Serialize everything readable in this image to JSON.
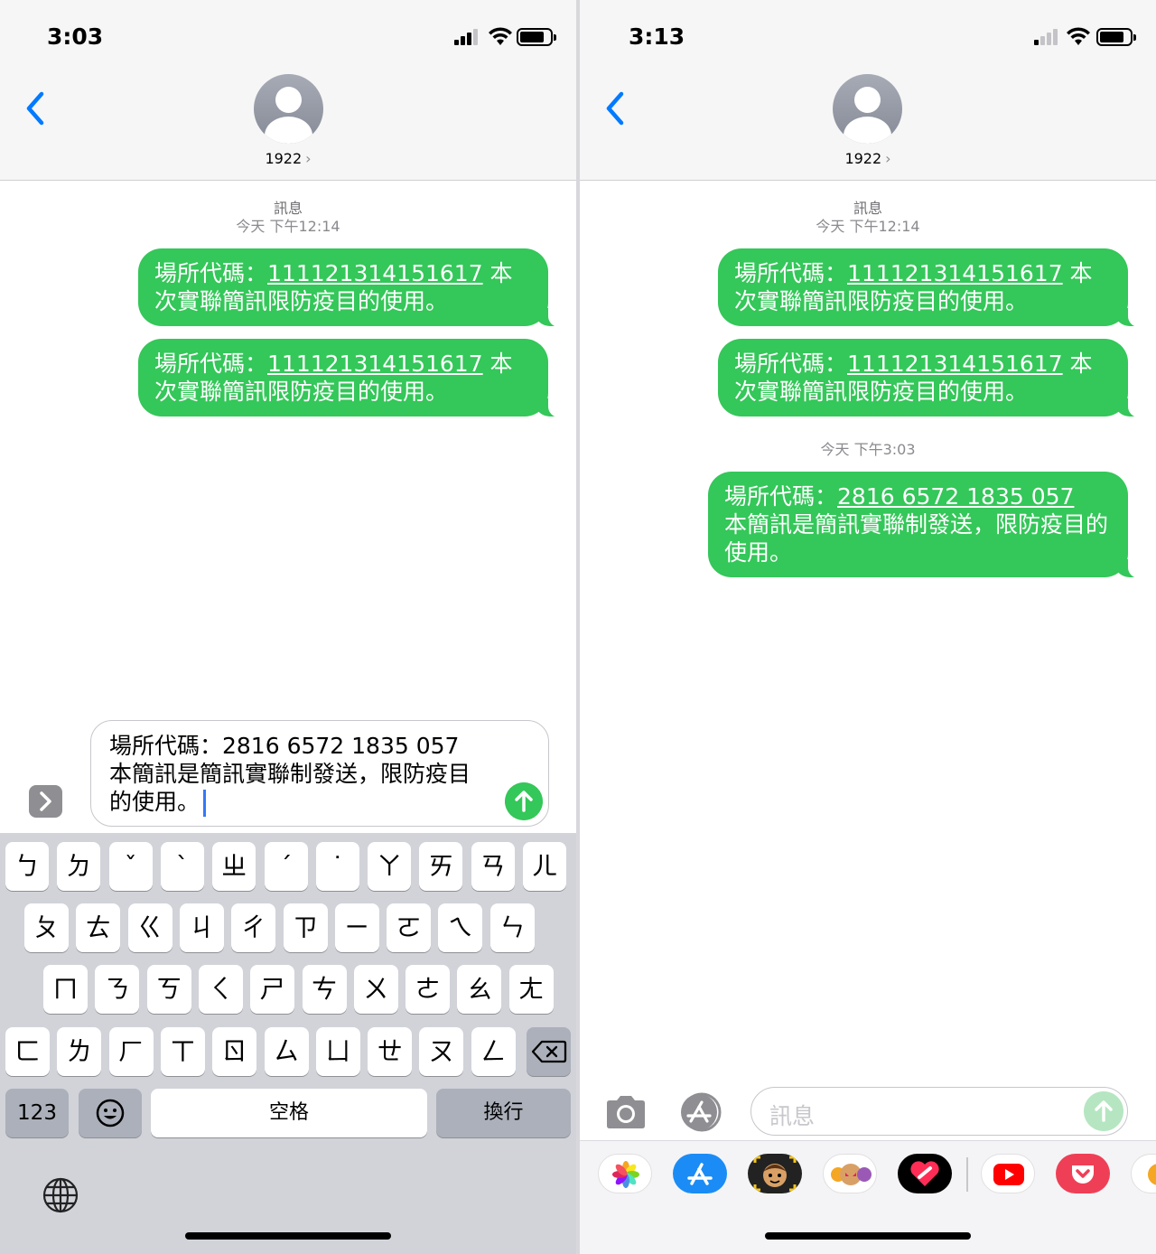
{
  "left": {
    "status": {
      "time": "3:03"
    },
    "contact": {
      "name": "1922",
      "chevron": "›"
    },
    "meta": {
      "service": "訊息",
      "timestamp": "今天 下午12:14"
    },
    "messages": [
      {
        "prefix": "場所代碼：",
        "code": "111121314151617",
        "rest": " 本次實聯簡訊限防疫目的使用。"
      },
      {
        "prefix": "場所代碼：",
        "code": "111121314151617",
        "rest": " 本次實聯簡訊限防疫目的使用。"
      }
    ],
    "compose": {
      "line1": "場所代碼：2816 6572 1835 057",
      "line2": "本簡訊是簡訊實聯制發送，限防疫目",
      "line3": "的使用。"
    },
    "keyboard": {
      "row1": [
        "ㄅ",
        "ㄉ",
        "ˇ",
        "ˋ",
        "ㄓ",
        "ˊ",
        "˙",
        "ㄚ",
        "ㄞ",
        "ㄢ",
        "ㄦ"
      ],
      "row2": [
        "ㄆ",
        "ㄊ",
        "ㄍ",
        "ㄐ",
        "ㄔ",
        "ㄗ",
        "ㄧ",
        "ㄛ",
        "ㄟ",
        "ㄣ"
      ],
      "row3": [
        "ㄇ",
        "ㄋ",
        "ㄎ",
        "ㄑ",
        "ㄕ",
        "ㄘ",
        "ㄨ",
        "ㄜ",
        "ㄠ",
        "ㄤ"
      ],
      "row4": [
        "ㄈ",
        "ㄌ",
        "ㄏ",
        "ㄒ",
        "ㄖ",
        "ㄙ",
        "ㄩ",
        "ㄝ",
        "ㄡ",
        "ㄥ"
      ],
      "numbers": "123",
      "space": "空格",
      "return": "換行"
    }
  },
  "right": {
    "status": {
      "time": "3:13"
    },
    "contact": {
      "name": "1922",
      "chevron": "›"
    },
    "meta": {
      "service": "訊息",
      "timestamp": "今天 下午12:14",
      "timestamp2": "今天 下午3:03"
    },
    "messages": [
      {
        "prefix": "場所代碼：",
        "code": "111121314151617",
        "rest": " 本次實聯簡訊限防疫目的使用。"
      },
      {
        "prefix": "場所代碼：",
        "code": "111121314151617",
        "rest": " 本次實聯簡訊限防疫目的使用。"
      },
      {
        "prefix": "場所代碼：",
        "code": "2816 6572 1835 057",
        "rest": "本簡訊是簡訊實聯制發送，限防疫目的使用。"
      }
    ],
    "compose": {
      "placeholder": "訊息"
    },
    "drawer": [
      "photos-app-icon",
      "app-store-icon",
      "memoji-icon",
      "animoji-stickers-icon",
      "digital-touch-icon",
      "youtube-icon",
      "pocket-icon",
      "more-app-icon"
    ]
  },
  "colors": {
    "bubble": "#34c759",
    "accent": "#007aff"
  }
}
